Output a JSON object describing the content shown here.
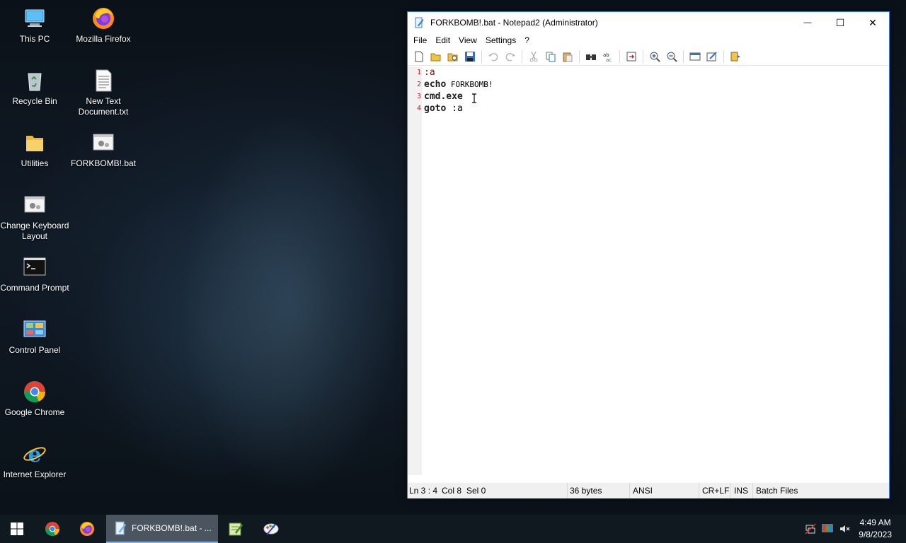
{
  "desktop": {
    "icons": [
      {
        "label": "This PC",
        "icon": "computer-icon"
      },
      {
        "label": "Mozilla Firefox",
        "icon": "firefox-icon"
      },
      {
        "label": "Recycle Bin",
        "icon": "recycle-bin-icon"
      },
      {
        "label": "New Text Document.txt",
        "icon": "text-file-icon"
      },
      {
        "label": "Utilities",
        "icon": "folder-icon"
      },
      {
        "label": "FORKBOMB!.bat",
        "icon": "batch-file-icon"
      },
      {
        "label": "Change Keyboard Layout",
        "icon": "batch-file-icon"
      },
      {
        "label": "Command Prompt",
        "icon": "terminal-icon"
      },
      {
        "label": "Control Panel",
        "icon": "control-panel-icon"
      },
      {
        "label": "Google Chrome",
        "icon": "chrome-icon"
      },
      {
        "label": "Internet Explorer",
        "icon": "ie-icon"
      }
    ]
  },
  "window": {
    "title": "FORKBOMB!.bat - Notepad2 (Administrator)",
    "controls": {
      "minimize": "—",
      "maximize": "☐",
      "close": "✕"
    },
    "menu": [
      "File",
      "Edit",
      "View",
      "Settings",
      "?"
    ],
    "toolbar": [
      "new-icon",
      "open-icon",
      "browse-icon",
      "save-icon",
      "undo-icon",
      "redo-icon",
      "cut-icon",
      "copy-icon",
      "paste-icon",
      "find-icon",
      "replace-icon",
      "goto-icon",
      "zoom-in-icon",
      "zoom-out-icon",
      "scheme-icon",
      "customize-icon",
      "settings-icon"
    ],
    "lines": [
      {
        "num": "1",
        "parts": [
          {
            "t": ":a",
            "c": "label"
          }
        ]
      },
      {
        "num": "2",
        "parts": [
          {
            "t": "echo",
            "c": "kw"
          },
          {
            "t": " FORKBOMB!",
            "c": "txt"
          }
        ]
      },
      {
        "num": "3",
        "parts": [
          {
            "t": "cmd.exe",
            "c": "kw"
          }
        ]
      },
      {
        "num": "4",
        "parts": [
          {
            "t": "goto",
            "c": "kw"
          },
          {
            "t": " :a",
            "c": "txt"
          }
        ]
      }
    ],
    "status": {
      "position": "Ln 3 : 4",
      "column": "Col 8",
      "selection": "Sel 0",
      "size": "36 bytes",
      "encoding": "ANSI",
      "line_ending": "CR+LF",
      "mode": "INS",
      "scheme": "Batch Files"
    }
  },
  "taskbar": {
    "notepad_label": "FORKBOMB!.bat - ...",
    "time": "4:49 AM",
    "date": "9/8/2023"
  },
  "colors": {
    "accent": "#3b7dd8",
    "line_number": "#c01c28",
    "taskbar": "#101820"
  }
}
